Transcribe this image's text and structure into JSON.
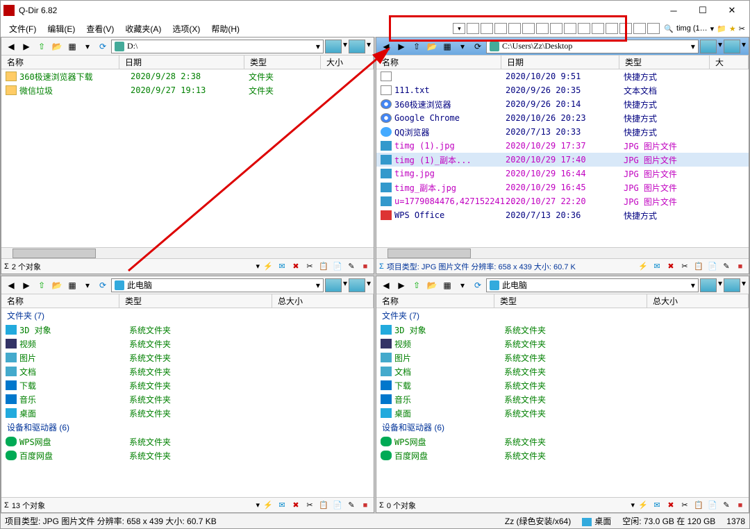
{
  "window": {
    "title": "Q-Dir 6.82"
  },
  "menu": [
    "文件(F)",
    "编辑(E)",
    "查看(V)",
    "收藏夹(A)",
    "选项(X)",
    "帮助(H)"
  ],
  "extra_tool_label": "timg (1…",
  "pane1": {
    "addr": "D:\\",
    "cols": [
      "名称",
      "日期",
      "类型",
      "大小"
    ],
    "rows": [
      {
        "icon": "fi-folder",
        "name": "360极速浏览器下载",
        "date": "2020/9/28 2:38",
        "type": "文件夹",
        "cls": "c-green"
      },
      {
        "icon": "fi-folder",
        "name": "微信垃圾",
        "date": "2020/9/27 19:13",
        "type": "文件夹",
        "cls": "c-green"
      }
    ],
    "status": "2 个对象"
  },
  "pane2": {
    "addr": "C:\\Users\\Zz\\Desktop",
    "cols": [
      "名称",
      "日期",
      "类型",
      "大"
    ],
    "rows": [
      {
        "icon": "fi-txt",
        "name": "",
        "date": "2020/10/20 9:51",
        "type": "快捷方式",
        "cls": "c-blue"
      },
      {
        "icon": "fi-txt",
        "name": "111.txt",
        "date": "2020/9/26 20:35",
        "type": "文本文档",
        "cls": "c-blue"
      },
      {
        "icon": "fi-chrome",
        "name": "360极速浏览器",
        "date": "2020/9/26 20:14",
        "type": "快捷方式",
        "cls": "c-blue"
      },
      {
        "icon": "fi-chrome",
        "name": "Google Chrome",
        "date": "2020/10/26 20:23",
        "type": "快捷方式",
        "cls": "c-blue"
      },
      {
        "icon": "fi-qq",
        "name": "QQ浏览器",
        "date": "2020/7/13 20:33",
        "type": "快捷方式",
        "cls": "c-blue"
      },
      {
        "icon": "fi-jpg",
        "name": "timg (1).jpg",
        "date": "2020/10/29 17:37",
        "type": "JPG 图片文件",
        "cls": "c-magenta"
      },
      {
        "icon": "fi-jpg",
        "name": "timg (1)_副本...",
        "date": "2020/10/29 17:40",
        "type": "JPG 图片文件",
        "cls": "c-magenta",
        "sel": true
      },
      {
        "icon": "fi-jpg",
        "name": "timg.jpg",
        "date": "2020/10/29 16:44",
        "type": "JPG 图片文件",
        "cls": "c-magenta"
      },
      {
        "icon": "fi-jpg",
        "name": "timg_副本.jpg",
        "date": "2020/10/29 16:45",
        "type": "JPG 图片文件",
        "cls": "c-magenta"
      },
      {
        "icon": "fi-jpg",
        "name": "u=1779084476,427152241...",
        "date": "2020/10/27 22:20",
        "type": "JPG 图片文件",
        "cls": "c-magenta"
      },
      {
        "icon": "fi-wps",
        "name": "WPS Office",
        "date": "2020/7/13 20:36",
        "type": "快捷方式",
        "cls": "c-blue"
      }
    ],
    "status": "项目类型: JPG 图片文件 分辨率: 658 x 439 大小: 60.7 K"
  },
  "pane3": {
    "addr": "此电脑",
    "cols": [
      "名称",
      "类型",
      "总大小"
    ],
    "group1": "文件夹 (7)",
    "rows1": [
      {
        "icon": "fi-3d",
        "name": "3D 对象",
        "type": "系统文件夹"
      },
      {
        "icon": "fi-video",
        "name": "视频",
        "type": "系统文件夹"
      },
      {
        "icon": "fi-pic",
        "name": "图片",
        "type": "系统文件夹"
      },
      {
        "icon": "fi-doc",
        "name": "文档",
        "type": "系统文件夹"
      },
      {
        "icon": "fi-down",
        "name": "下载",
        "type": "系统文件夹"
      },
      {
        "icon": "fi-music",
        "name": "音乐",
        "type": "系统文件夹"
      },
      {
        "icon": "fi-desk",
        "name": "桌面",
        "type": "系统文件夹"
      }
    ],
    "group2": "设备和驱动器 (6)",
    "rows2": [
      {
        "icon": "fi-cloud",
        "name": "WPS网盘",
        "type": "系统文件夹"
      },
      {
        "icon": "fi-cloud",
        "name": "百度网盘",
        "type": "系统文件夹"
      }
    ],
    "status": "13 个对象"
  },
  "pane4": {
    "addr": "此电脑",
    "cols": [
      "名称",
      "类型",
      "总大小"
    ],
    "group1": "文件夹 (7)",
    "rows1": [
      {
        "icon": "fi-3d",
        "name": "3D 对象",
        "type": "系统文件夹"
      },
      {
        "icon": "fi-video",
        "name": "视频",
        "type": "系统文件夹"
      },
      {
        "icon": "fi-pic",
        "name": "图片",
        "type": "系统文件夹"
      },
      {
        "icon": "fi-doc",
        "name": "文档",
        "type": "系统文件夹"
      },
      {
        "icon": "fi-down",
        "name": "下载",
        "type": "系统文件夹"
      },
      {
        "icon": "fi-music",
        "name": "音乐",
        "type": "系统文件夹"
      },
      {
        "icon": "fi-desk",
        "name": "桌面",
        "type": "系统文件夹"
      }
    ],
    "group2": "设备和驱动器 (6)",
    "rows2": [
      {
        "icon": "fi-cloud",
        "name": "WPS网盘",
        "type": "系统文件夹"
      },
      {
        "icon": "fi-cloud",
        "name": "百度网盘",
        "type": "系统文件夹"
      }
    ],
    "status": "0 个对象"
  },
  "status": {
    "left": "项目类型: JPG 图片文件 分辨率: 658 x 439 大小: 60.7 KB",
    "mid": "Zz (绿色安装/x64)",
    "desk": "桌面",
    "disk": "空闲: 73.0 GB 在 120 GB",
    "num": "1378"
  }
}
